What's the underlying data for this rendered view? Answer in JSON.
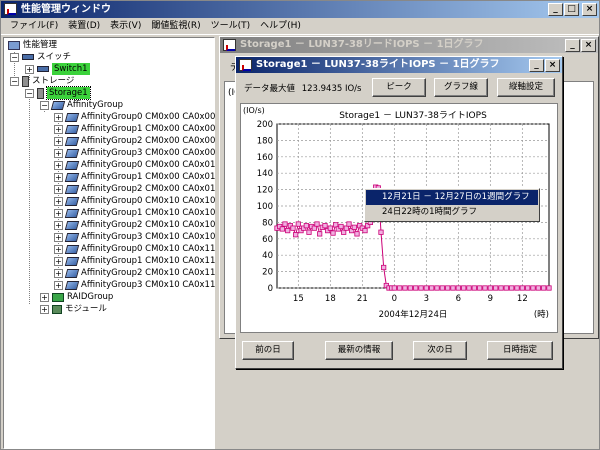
{
  "window": {
    "title": "性能管理ウィンドウ"
  },
  "menu": [
    "ファイル(F)",
    "装置(D)",
    "表示(V)",
    "閾値監視(R)",
    "ツール(T)",
    "ヘルプ(H)"
  ],
  "tree": {
    "root": "性能管理",
    "switch_label": "スイッチ",
    "switch_item": "Switch1",
    "storage_label": "ストレージ",
    "storage_item": "Storage1",
    "affinity_label": "AffinityGroup",
    "groups": [
      "AffinityGroup0 CM0x00 CA0x00",
      "AffinityGroup1 CM0x00 CA0x00",
      "AffinityGroup2 CM0x00 CA0x00",
      "AffinityGroup3 CM0x00 CA0x00",
      "AffinityGroup0 CM0x00 CA0x01",
      "AffinityGroup1 CM0x00 CA0x01",
      "AffinityGroup2 CM0x00 CA0x01",
      "AffinityGroup0 CM0x10 CA0x10",
      "AffinityGroup1 CM0x10 CA0x10",
      "AffinityGroup2 CM0x10 CA0x10",
      "AffinityGroup3 CM0x10 CA0x10",
      "AffinityGroup0 CM0x10 CA0x11",
      "AffinityGroup1 CM0x10 CA0x11",
      "AffinityGroup2 CM0x10 CA0x11",
      "AffinityGroup3 CM0x10 CA0x11"
    ],
    "raid_label": "RAIDGroup",
    "module_label": "モジュール"
  },
  "bg_window": {
    "title": "Storage1 － LUN37-38リードIOPS － 1日グラフ",
    "tab_stub": "デ",
    "panel_stub": "(IO"
  },
  "fg_window": {
    "title": "Storage1 － LUN37-38ライトIOPS － 1日グラフ",
    "max_label": "データ最大値",
    "max_value": "123.9435 IO/s",
    "buttons": {
      "peak": "ピーク",
      "line": "グラフ線",
      "axis": "縦軸設定"
    },
    "bottom_buttons": {
      "prev": "前の日",
      "latest": "最新の情報",
      "next": "次の日",
      "datetime": "日時指定"
    }
  },
  "context_menu": [
    "12月21日 － 12月27日の1週間グラフ",
    "24日22時の1時間グラフ"
  ],
  "chart_data": {
    "type": "line",
    "title": "Storage1 － LUN37-38ライトIOPS",
    "ylabel": "(IO/s)",
    "xlabel": "2004年12月24日",
    "x_unit_label": "(時)",
    "ylim": [
      0,
      200
    ],
    "yticks": [
      0,
      20,
      40,
      60,
      80,
      100,
      120,
      140,
      160,
      180,
      200
    ],
    "xtick_labels": [
      "15",
      "18",
      "21",
      "0",
      "3",
      "6",
      "9",
      "12"
    ],
    "xtick_hours": [
      15,
      18,
      21,
      24,
      27,
      30,
      33,
      36
    ],
    "xlim_hours": [
      13,
      38.5
    ],
    "grid": true,
    "series": [
      {
        "color": "#cc0077",
        "x": [
          13.0,
          13.25,
          13.5,
          13.75,
          14.0,
          14.25,
          14.5,
          14.75,
          15.0,
          15.25,
          15.5,
          15.75,
          16.0,
          16.25,
          16.5,
          16.75,
          17.0,
          17.25,
          17.5,
          17.75,
          18.0,
          18.25,
          18.5,
          18.75,
          19.0,
          19.25,
          19.5,
          19.75,
          20.0,
          20.25,
          20.5,
          20.75,
          21.0,
          21.25,
          21.5,
          21.75,
          22.0,
          22.25,
          22.5,
          22.75,
          23.0,
          23.25,
          23.5,
          23.75,
          24.0,
          24.5,
          25.0,
          25.5,
          26.0,
          26.5,
          27.0,
          27.5,
          28.0,
          28.5,
          29.0,
          29.5,
          30.0,
          30.5,
          31.0,
          31.5,
          32.0,
          32.5,
          33.0,
          33.5,
          34.0,
          34.5,
          35.0,
          35.5,
          36.0,
          36.5,
          37.0,
          37.5,
          38.0,
          38.5
        ],
        "y": [
          73,
          75,
          72,
          78,
          70,
          76,
          73,
          65,
          78,
          70,
          73,
          76,
          68,
          75,
          73,
          78,
          66,
          74,
          76,
          70,
          73,
          67,
          77,
          72,
          75,
          68,
          73,
          78,
          70,
          74,
          66,
          76,
          73,
          70,
          76,
          80,
          90,
          123,
          122,
          68,
          25,
          3,
          0,
          0,
          0,
          0,
          0,
          0,
          0,
          0,
          0,
          0,
          0,
          0,
          0,
          0,
          0,
          0,
          0,
          0,
          0,
          0,
          0,
          0,
          0,
          0,
          0,
          0,
          0,
          0,
          0,
          0,
          0,
          0
        ]
      }
    ]
  }
}
